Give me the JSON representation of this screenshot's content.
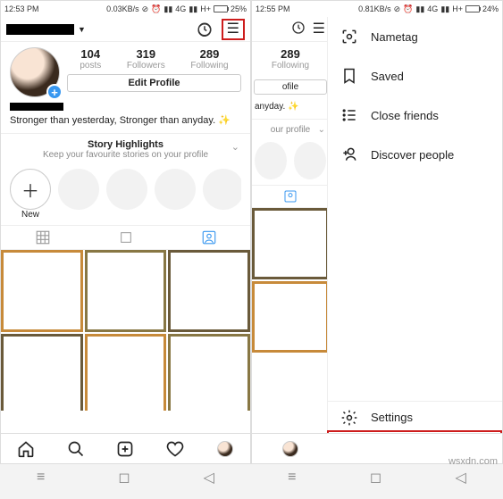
{
  "left": {
    "status": {
      "time": "12:53 PM",
      "net": "0.03KB/s",
      "sig": "4G",
      "sig2": "H+",
      "batt": "25%",
      "batt_fill": 25
    },
    "username_hidden": true,
    "stats": {
      "posts": "104",
      "posts_lbl": "posts",
      "followers": "319",
      "followers_lbl": "Followers",
      "following": "289",
      "following_lbl": "Following"
    },
    "edit_btn": "Edit Profile",
    "bio": "Stronger than yesterday, Stronger than anyday. ✨",
    "highlights": {
      "title": "Story Highlights",
      "sub": "Keep your favourite stories on your profile",
      "new": "New"
    }
  },
  "right": {
    "status": {
      "time": "12:55 PM",
      "net": "0.81KB/s",
      "sig": "4G",
      "sig2": "H+",
      "batt": "24%",
      "batt_fill": 24
    },
    "strip": {
      "following": "289",
      "following_lbl": "Following",
      "edit": "ofile",
      "bio": "anyday. ✨",
      "hl_sub": "our profile"
    },
    "menu": {
      "nametag": "Nametag",
      "saved": "Saved",
      "close_friends": "Close friends",
      "discover": "Discover people",
      "settings": "Settings"
    }
  },
  "watermark": "wsxdn.com"
}
